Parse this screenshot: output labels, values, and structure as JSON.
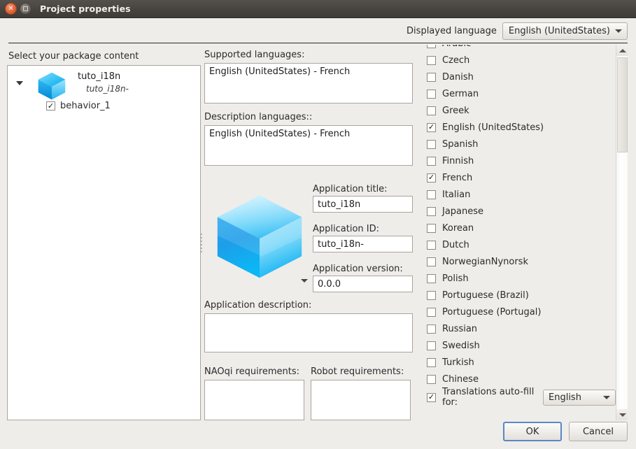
{
  "window": {
    "title": "Project properties",
    "close_icon": "close-icon",
    "maximize_icon": "maximize-icon"
  },
  "header": {
    "displayed_language_label": "Displayed language",
    "displayed_language_value": "English (UnitedStates)"
  },
  "left_panel": {
    "label": "Select your package content",
    "tree": {
      "expander_icon": "chevron-down-icon",
      "project_icon": "cube-icon",
      "project_name": "tuto_i18n",
      "project_id": "tuto_i18n-",
      "child": {
        "label": "behavior_1",
        "checked": true
      }
    }
  },
  "middle_panel": {
    "supported_languages_label": "Supported languages:",
    "supported_languages_value": "English (UnitedStates) - French",
    "description_languages_label": "Description languages::",
    "description_languages_value": "English (UnitedStates) - French",
    "app_icon": "cube-icon",
    "app_icon_dropdown_icon": "chevron-down-icon",
    "application_title_label": "Application title:",
    "application_title_value": "tuto_i18n",
    "application_id_label": "Application ID:",
    "application_id_value": "tuto_i18n-",
    "application_version_label": "Application version:",
    "application_version_value": "0.0.0",
    "application_description_label": "Application description:",
    "application_description_value": "",
    "naoqi_requirements_label": "NAOqi requirements:",
    "naoqi_requirements_value": "",
    "robot_requirements_label": "Robot requirements:",
    "robot_requirements_value": ""
  },
  "language_list": {
    "items": [
      {
        "label": "Arabic",
        "checked": false
      },
      {
        "label": "Czech",
        "checked": false
      },
      {
        "label": "Danish",
        "checked": false
      },
      {
        "label": "German",
        "checked": false
      },
      {
        "label": "Greek",
        "checked": false
      },
      {
        "label": "English (UnitedStates)",
        "checked": true
      },
      {
        "label": "Spanish",
        "checked": false
      },
      {
        "label": "Finnish",
        "checked": false
      },
      {
        "label": "French",
        "checked": true
      },
      {
        "label": "Italian",
        "checked": false
      },
      {
        "label": "Japanese",
        "checked": false
      },
      {
        "label": "Korean",
        "checked": false
      },
      {
        "label": "Dutch",
        "checked": false
      },
      {
        "label": "NorwegianNynorsk",
        "checked": false
      },
      {
        "label": "Polish",
        "checked": false
      },
      {
        "label": "Portuguese (Brazil)",
        "checked": false
      },
      {
        "label": "Portuguese (Portugal)",
        "checked": false
      },
      {
        "label": "Russian",
        "checked": false
      },
      {
        "label": "Swedish",
        "checked": false
      },
      {
        "label": "Turkish",
        "checked": false
      },
      {
        "label": "Chinese",
        "checked": false
      }
    ],
    "autofill": {
      "label": "Translations auto-fill for:",
      "checked": true,
      "value": "English"
    },
    "scrollbar": {
      "up_icon": "scroll-up-icon",
      "down_icon": "scroll-down-icon"
    }
  },
  "footer": {
    "ok_label": "OK",
    "cancel_label": "Cancel"
  },
  "colors": {
    "window_background": "#efedea",
    "titlebar": "#48443f",
    "close_button": "#e2653a",
    "field_background": "#ffffff",
    "field_border": "#aaa49d",
    "default_button_focus": "#5a87c4",
    "cube_primary": "#29b6f6"
  }
}
